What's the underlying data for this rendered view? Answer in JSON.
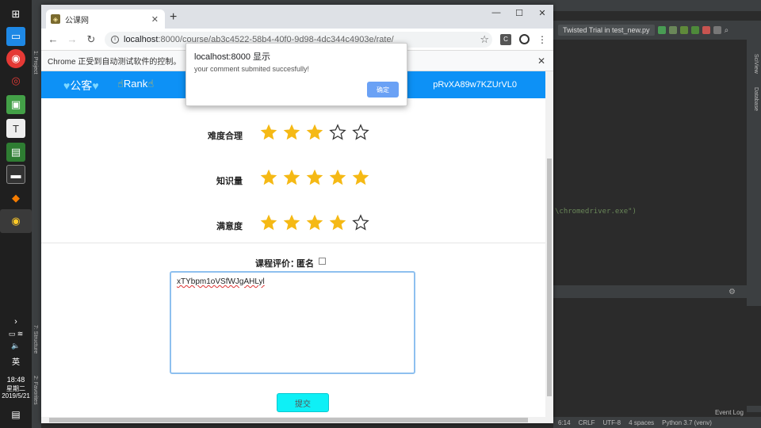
{
  "taskbar": {
    "clock_time": "18:48",
    "clock_weekday": "星期二",
    "clock_date": "2019/5/21",
    "ime": "英"
  },
  "ide": {
    "run_config": "Twisted Trial in test_new.py",
    "code_snippet": "\\chromedriver.exe\")",
    "status_position": "6:14",
    "status_line_sep": "CRLF",
    "status_encoding": "UTF-8",
    "status_indent": "4 spaces",
    "status_interpreter": "Python 3.7 (venv)",
    "event_log": "Event Log",
    "side_label_scview": "SciView",
    "side_label_database": "Database",
    "side_label_project": "1: Project",
    "side_label_structure": "7: Structure",
    "side_label_favorites": "2: Favorites"
  },
  "browser": {
    "tab_title": "公课网",
    "url_host": "localhost",
    "url_path": ":8000/course/ab3c4522-58b4-40f0-9d98-4dc344c4903e/rate/",
    "infobar_text": "Chrome 正受到自动测试软件的控制。"
  },
  "site": {
    "brand": "公客",
    "rank": "Rank",
    "username": "pRvXA89w7KZUrVL0"
  },
  "ratings": [
    {
      "label": "难度合理",
      "value": 3,
      "max": 5
    },
    {
      "label": "知识量",
      "value": 5,
      "max": 5
    },
    {
      "label": "满意度",
      "value": 4,
      "max": 5
    }
  ],
  "comment": {
    "label": "课程评价：",
    "anonymous_label": "匿名",
    "anonymous_checked": false,
    "text": "xTYbpm1oVSfWJgAHLyl"
  },
  "submit_label": "提交",
  "alert": {
    "title": "localhost:8000 显示",
    "message": "your comment submited succesfully!",
    "ok_label": "确定"
  },
  "colors": {
    "navbar": "#0d91f6",
    "star_filled": "#f5b915",
    "submit_button": "#0ef0f6",
    "alert_ok": "#6aa1f5"
  }
}
